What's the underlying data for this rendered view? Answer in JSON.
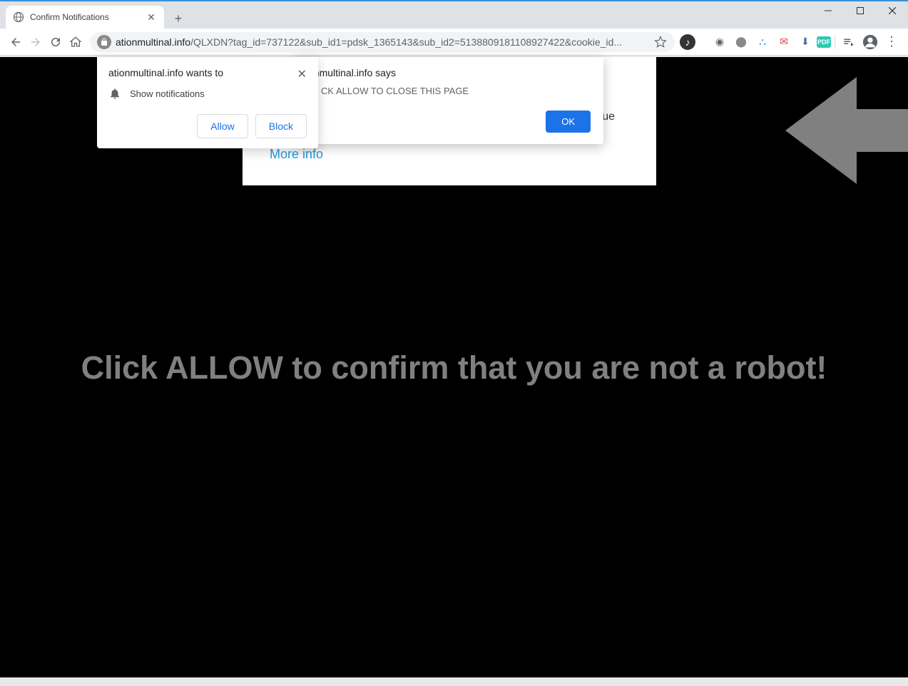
{
  "tab": {
    "title": "Confirm Notifications"
  },
  "url": {
    "domain": "ationmultinal.info",
    "path": "/QLXDN?tag_id=737122&sub_id1=pdsk_1365143&sub_id2=5138809181108927422&cookie_id..."
  },
  "permission_popup": {
    "origin": "ationmultinal.info wants to",
    "body": "Show notifications",
    "allow": "Allow",
    "block": "Block"
  },
  "alert_popup": {
    "title": "onmultinal.info says",
    "body": "CK ALLOW TO CLOSE THIS PAGE",
    "ok": "OK"
  },
  "page": {
    "continue_fragment": "ue",
    "more_info": "More info",
    "headline": "Click ALLOW to confirm that you are not a robot!"
  }
}
